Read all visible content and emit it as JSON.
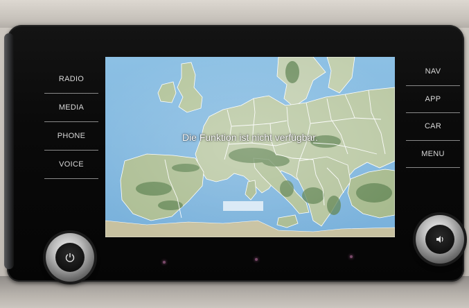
{
  "left_softkeys": [
    {
      "label": "RADIO"
    },
    {
      "label": "MEDIA"
    },
    {
      "label": "PHONE"
    },
    {
      "label": "VOICE"
    }
  ],
  "right_softkeys": [
    {
      "label": "NAV"
    },
    {
      "label": "APP"
    },
    {
      "label": "CAR"
    },
    {
      "label": "MENU"
    }
  ],
  "screen": {
    "message": "Die Funktion ist nicht verfügbar."
  },
  "colors": {
    "sea": "#7fb4db",
    "land": "#b9c8a6",
    "mountains": "#6f8f5e",
    "borders": "#ffffff",
    "softkey_text": "#d9d9d9"
  },
  "icons": {
    "left_knob": "power-icon",
    "right_knob": "volume-icon"
  }
}
